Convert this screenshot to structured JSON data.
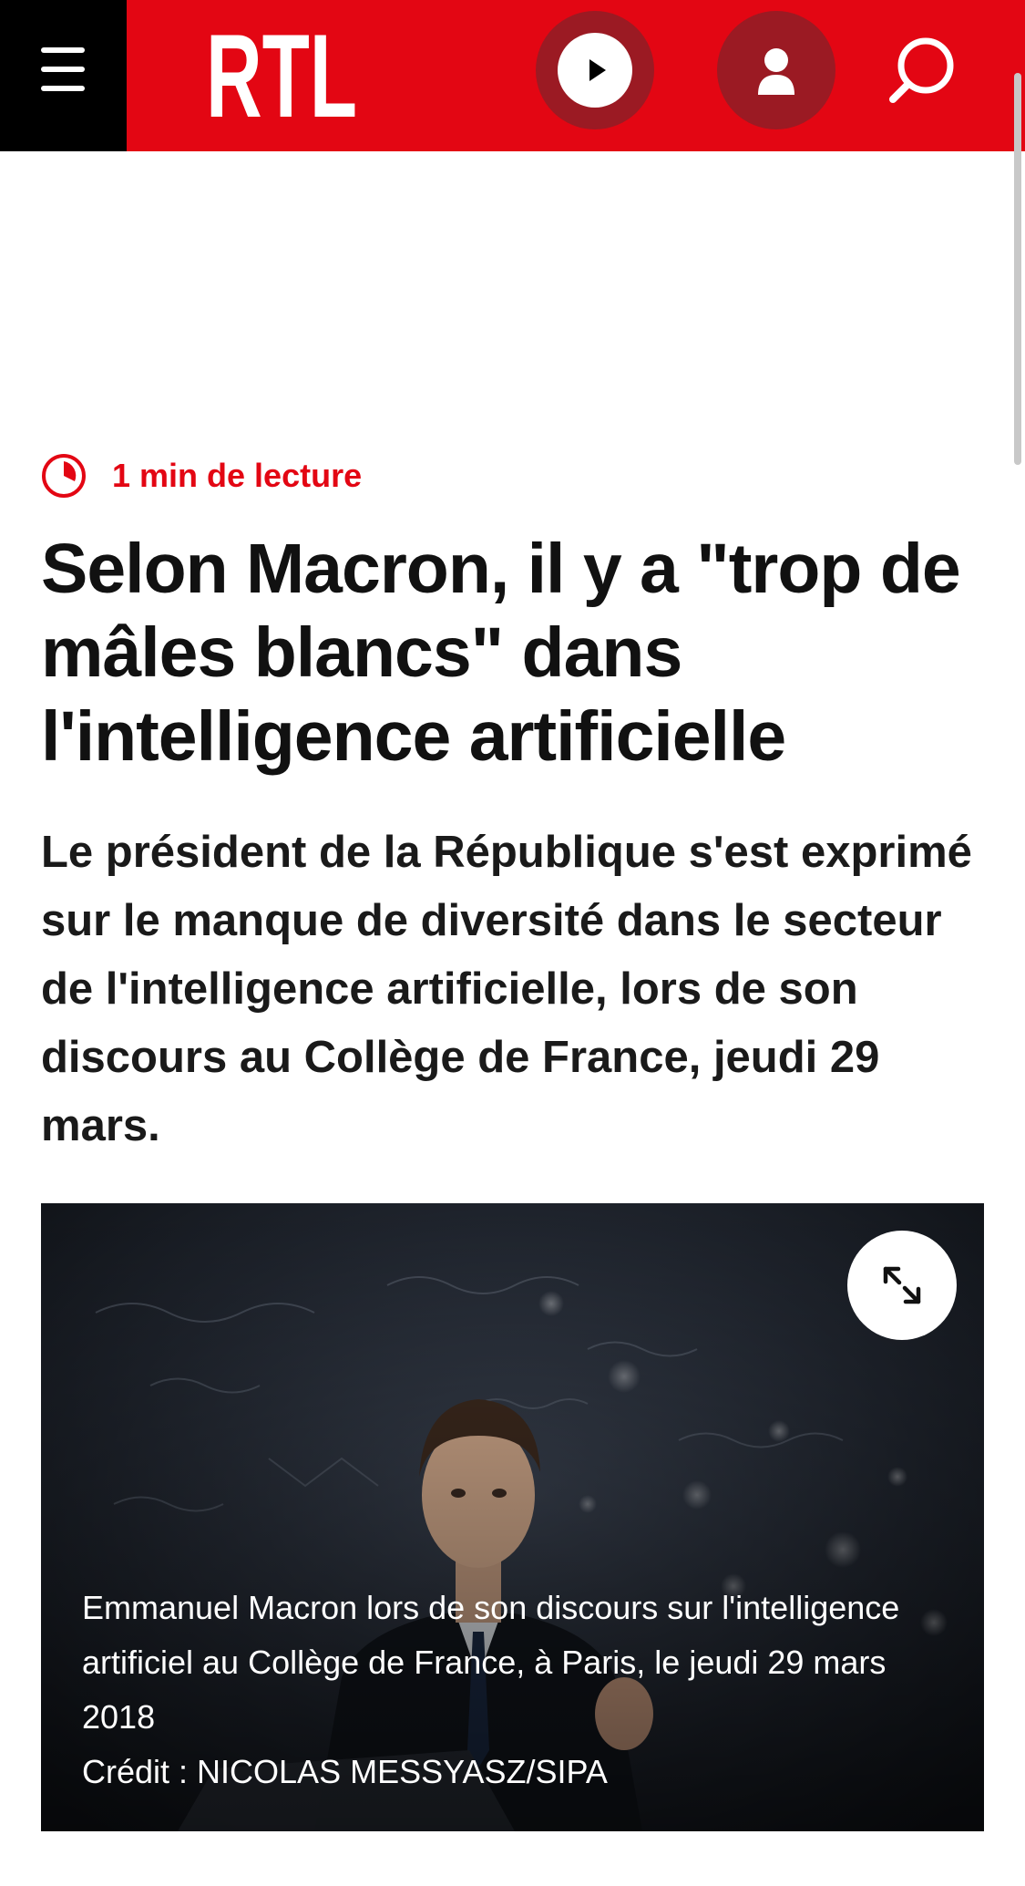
{
  "header": {
    "logo_text": "RTL",
    "brand_color": "#e30613",
    "menu_icon": "hamburger-menu-icon",
    "play_icon": "play-icon",
    "account_icon": "user-icon",
    "search_icon": "search-icon"
  },
  "article": {
    "reading_time": "1 min de lecture",
    "title": "Selon Macron, il y a \"trop de mâles blancs\" dans l'intelligence artificielle",
    "lead": "Le président de la République s'est exprimé sur le manque de diversité dans le secteur de l'intelligence artificielle, lors de son discours au Collège de France, jeudi 29 mars.",
    "image": {
      "caption": "Emmanuel Macron lors de son discours sur l'intelligence artificiel au Collège de France, à Paris, le jeudi 29 mars 2018",
      "credit": "Crédit : NICOLAS MESSYASZ/SIPA",
      "expand_icon": "expand-icon"
    }
  }
}
